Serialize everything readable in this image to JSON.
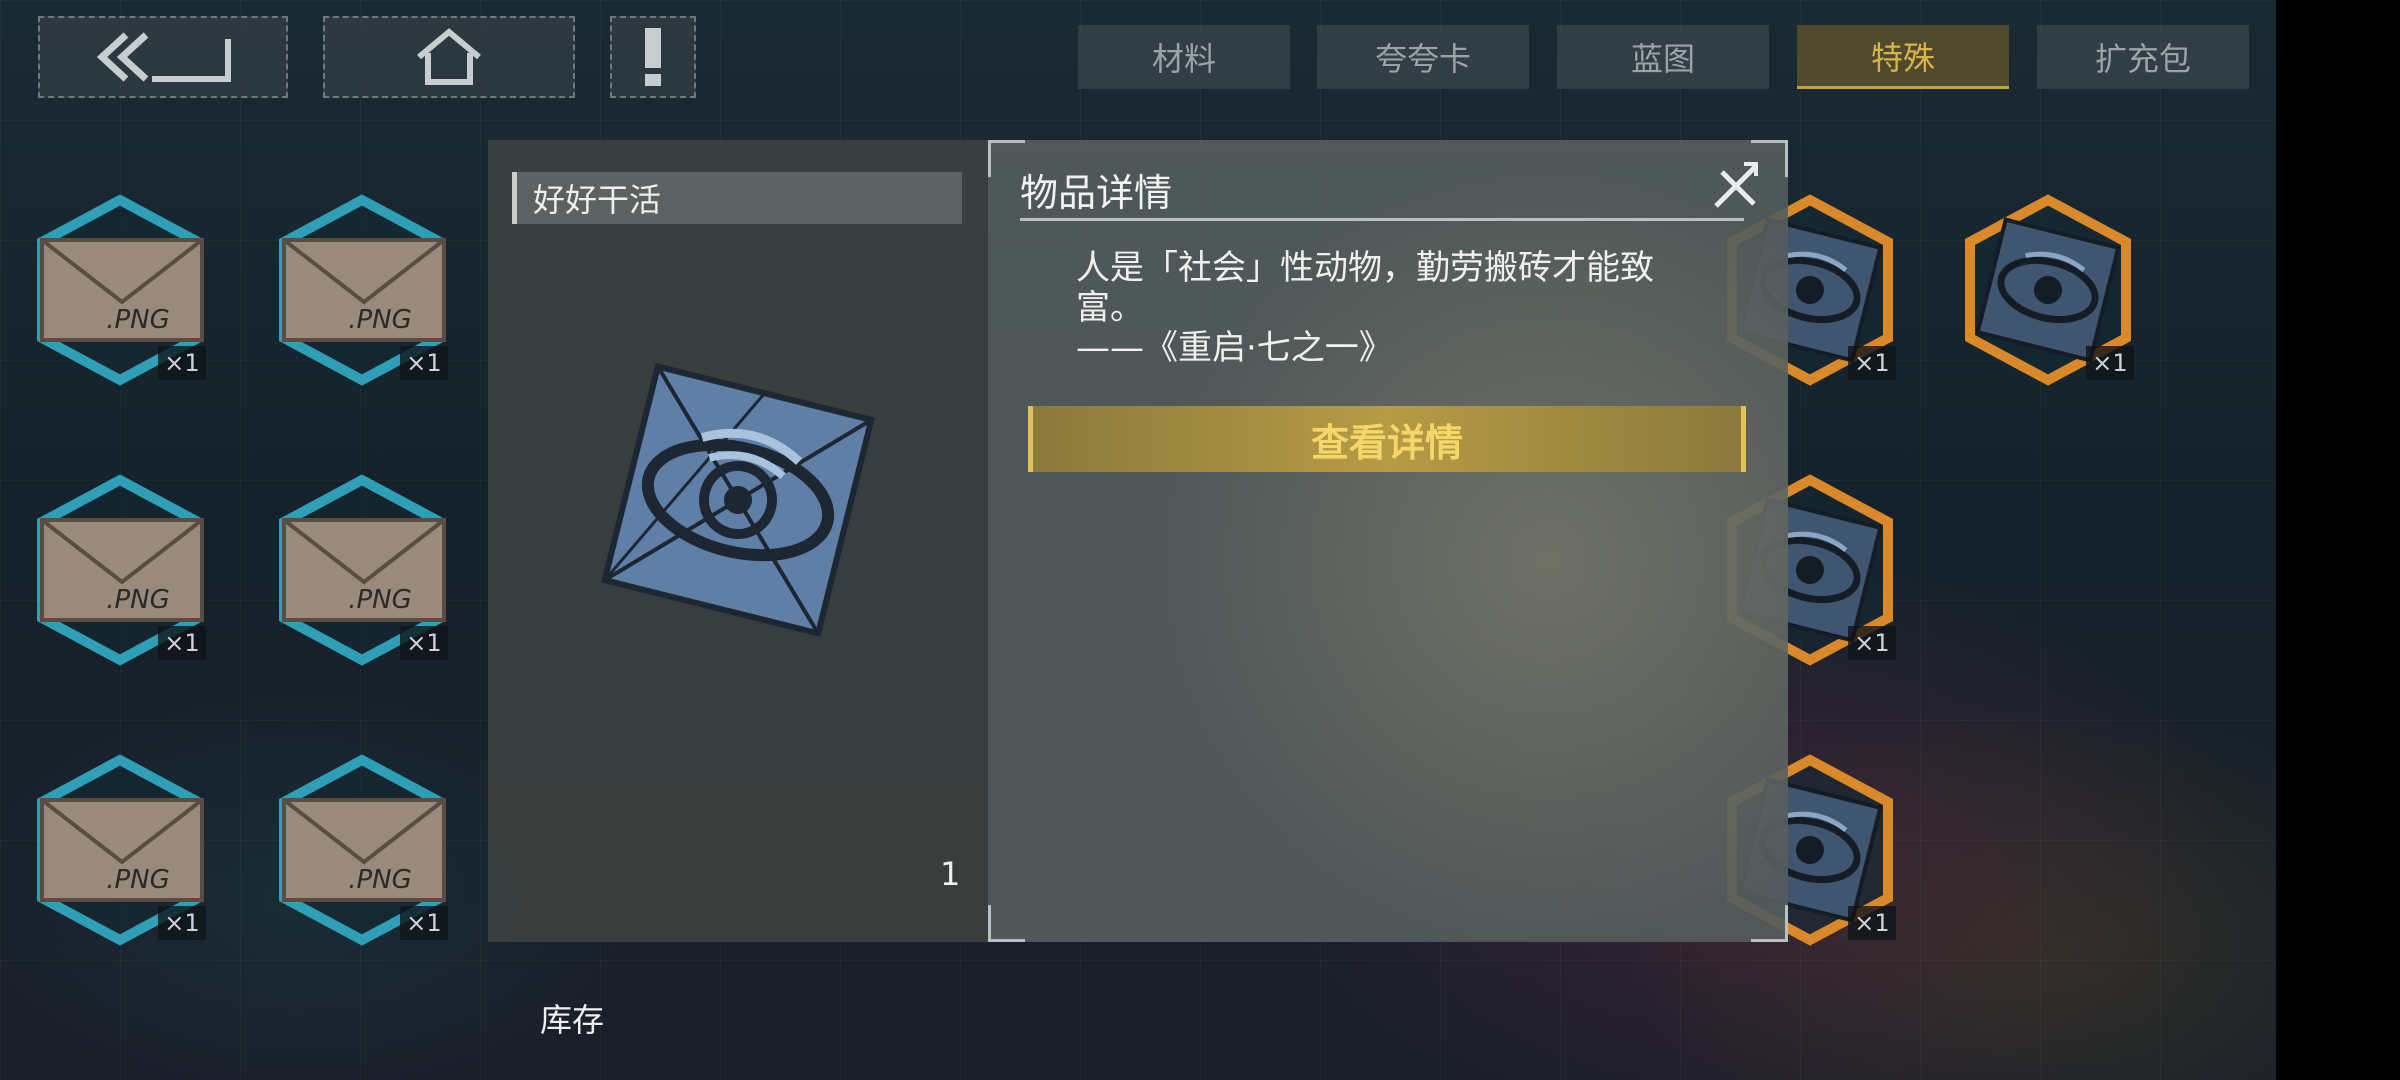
{
  "nav": {
    "back_icon": "double-chevron-left-icon",
    "home_icon": "home-icon",
    "alert_icon": "exclamation-icon"
  },
  "tabs": [
    {
      "label": "材料",
      "active": false
    },
    {
      "label": "夸夸卡",
      "active": false
    },
    {
      "label": "蓝图",
      "active": false
    },
    {
      "label": "特殊",
      "active": true
    },
    {
      "label": "扩充包",
      "active": false
    }
  ],
  "inventory": {
    "envelope_label": ".PNG",
    "count_label": "×1",
    "colors": {
      "teal": "#2f9fb8",
      "orange": "#d9882a"
    }
  },
  "dialog": {
    "item_name": "好好干活",
    "stock_label": "库存",
    "stock_value": "1",
    "title": "物品详情",
    "description": "人是「社会」性动物，勤劳搬砖才能致富。",
    "quote": "——《重启·七之一》",
    "view_button": "查看详情",
    "close_icon": "close-icon"
  },
  "colors": {
    "accent_gold": "#d8b24a",
    "button_gold": "#b79b45"
  }
}
